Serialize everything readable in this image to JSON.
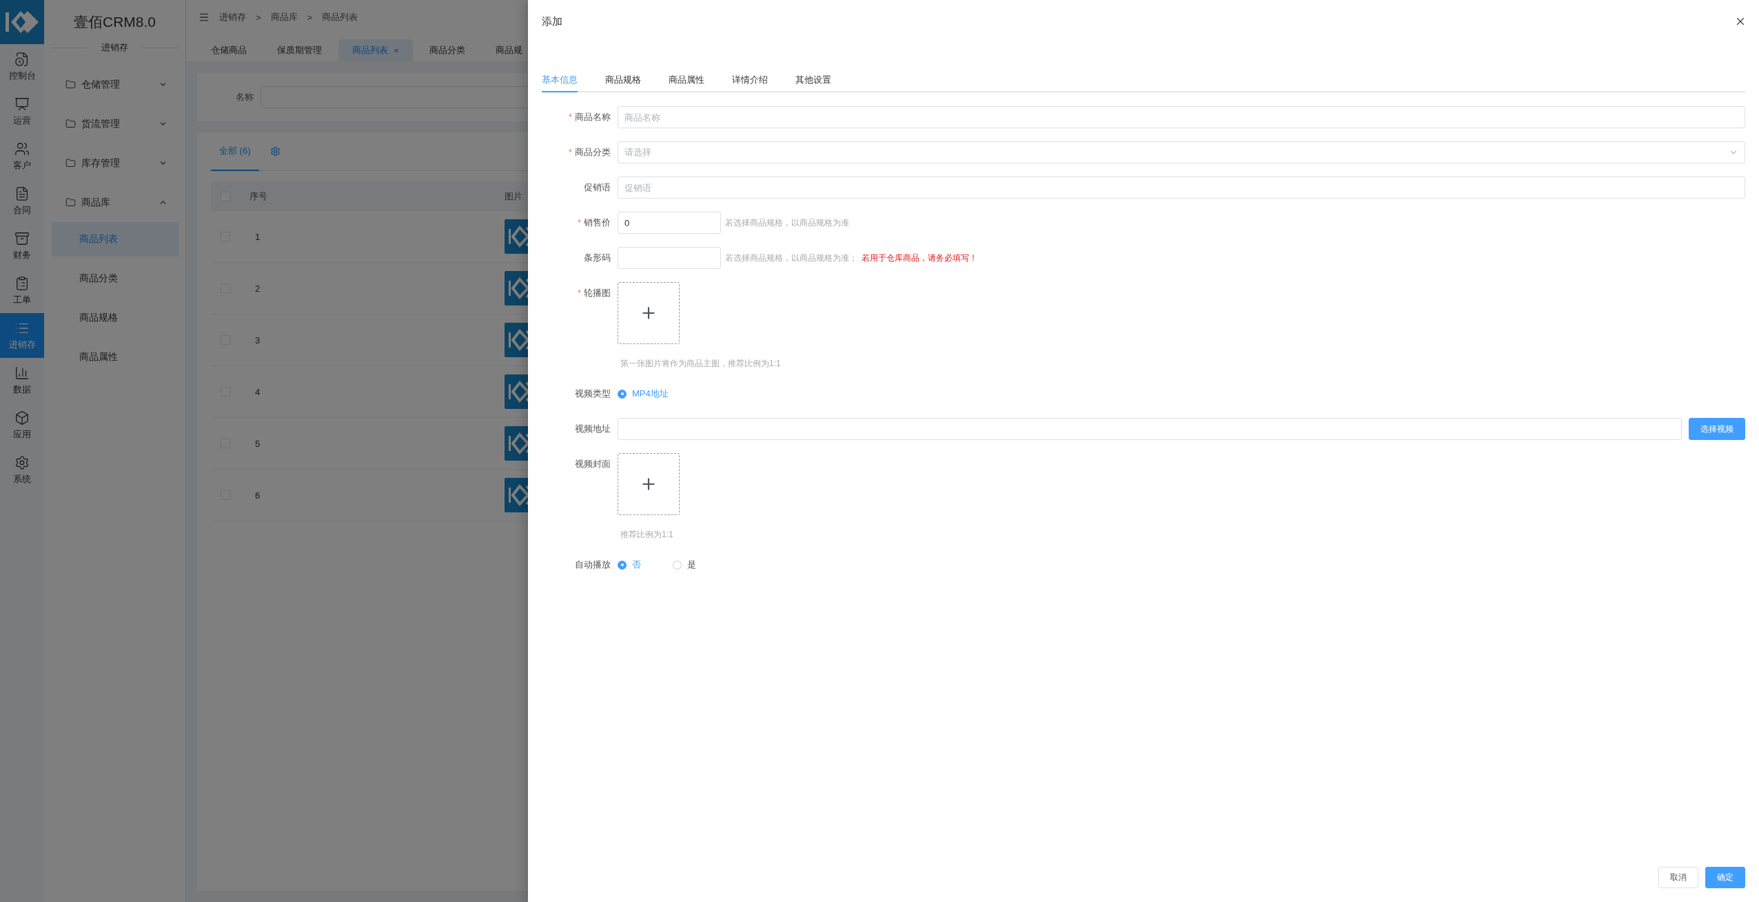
{
  "rail": {
    "items": [
      {
        "label": "控制台",
        "selected": false
      },
      {
        "label": "运营",
        "selected": false
      },
      {
        "label": "客户",
        "selected": false
      },
      {
        "label": "合同",
        "selected": false
      },
      {
        "label": "财务",
        "selected": false
      },
      {
        "label": "工单",
        "selected": false
      },
      {
        "label": "进销存",
        "selected": true
      },
      {
        "label": "数据",
        "selected": false
      },
      {
        "label": "应用",
        "selected": false
      },
      {
        "label": "系统",
        "selected": false
      }
    ]
  },
  "sidebar": {
    "title": "壹佰CRM8.0",
    "section": "进销存",
    "menu": [
      {
        "label": "仓储管理",
        "expanded": false
      },
      {
        "label": "货流管理",
        "expanded": false
      },
      {
        "label": "库存管理",
        "expanded": false
      },
      {
        "label": "商品库",
        "expanded": true,
        "children": [
          {
            "label": "商品列表",
            "selected": true
          },
          {
            "label": "商品分类",
            "selected": false
          },
          {
            "label": "商品规格",
            "selected": false
          },
          {
            "label": "商品属性",
            "selected": false
          }
        ]
      }
    ]
  },
  "header": {
    "breadcrumb": [
      "进销存",
      "商品库",
      "商品列表"
    ],
    "separator": ">"
  },
  "page_tabs": [
    {
      "label": "仓储商品",
      "selected": false,
      "closable": false
    },
    {
      "label": "保质期管理",
      "selected": false,
      "closable": false
    },
    {
      "label": "商品列表",
      "selected": true,
      "closable": true
    },
    {
      "label": "商品分类",
      "selected": false,
      "closable": false
    },
    {
      "label": "商品规",
      "selected": false,
      "closable": false
    }
  ],
  "tab_close_mark": "×",
  "filter": {
    "label": "名称"
  },
  "list": {
    "tabs": [
      {
        "label": "全部 (6)",
        "selected": true
      }
    ],
    "columns": [
      "序号",
      "图片"
    ],
    "header_checked": false,
    "rows": [
      {
        "index": "1",
        "checked": false
      },
      {
        "index": "2",
        "checked": false
      },
      {
        "index": "3",
        "checked": false
      },
      {
        "index": "4",
        "checked": false
      },
      {
        "index": "5",
        "checked": false
      },
      {
        "index": "6",
        "checked": false
      }
    ]
  },
  "drawer": {
    "title": "添加",
    "required_mark": "*",
    "tabs": [
      {
        "label": "基本信息",
        "selected": true
      },
      {
        "label": "商品规格",
        "selected": false
      },
      {
        "label": "商品属性",
        "selected": false
      },
      {
        "label": "详情介绍",
        "selected": false
      },
      {
        "label": "其他设置",
        "selected": false
      }
    ],
    "fields": [
      {
        "kind": "input",
        "label": "商品名称",
        "required": true,
        "placeholder": "商品名称"
      },
      {
        "kind": "select",
        "label": "商品分类",
        "required": true,
        "placeholder": "请选择"
      },
      {
        "kind": "input",
        "label": "促销语",
        "required": false,
        "placeholder": "促销语"
      },
      {
        "kind": "short_input",
        "label": "销售价",
        "required": true,
        "value": "0",
        "hint": "若选择商品规格，以商品规格为准"
      },
      {
        "kind": "short_input",
        "label": "条形码",
        "required": false,
        "hint": "若选择商品规格，以商品规格为准；",
        "warning": "若用于仓库商品，请务必填写！"
      },
      {
        "kind": "upload",
        "label": "轮播图",
        "required": true,
        "tip": "第一张图片将作为商品主图，推荐比例为1:1"
      },
      {
        "kind": "radio",
        "label": "视频类型",
        "required": false,
        "options": [
          {
            "label": "MP4地址",
            "selected": true
          }
        ]
      },
      {
        "kind": "input_button",
        "label": "视频地址",
        "required": false,
        "button": "选择视频"
      },
      {
        "kind": "upload",
        "label": "视频封面",
        "required": false,
        "tip": "推荐比例为1:1"
      },
      {
        "kind": "radio",
        "label": "自动播放",
        "required": false,
        "options": [
          {
            "label": "否",
            "selected": true
          },
          {
            "label": "是",
            "selected": false
          }
        ]
      }
    ],
    "buttons": [
      {
        "label": "取消",
        "kind": "default"
      },
      {
        "label": "确定",
        "kind": "primary"
      }
    ]
  }
}
